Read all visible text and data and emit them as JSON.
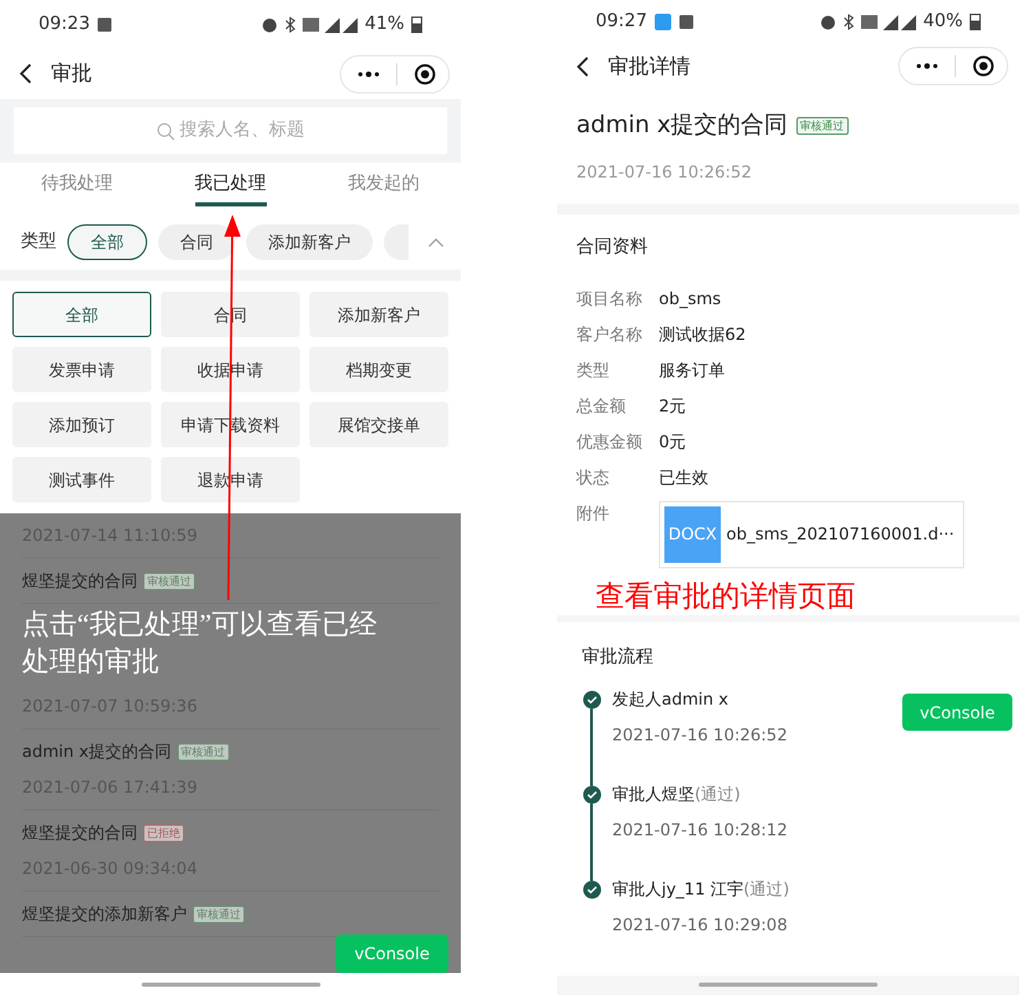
{
  "left_phone": {
    "status_bar": {
      "time": "09:23",
      "battery": "41%"
    },
    "nav": {
      "title": "审批"
    },
    "search": {
      "placeholder": "搜索人名、标题"
    },
    "tabs": [
      {
        "label": "待我处理",
        "selected": false
      },
      {
        "label": "我已处理",
        "selected": true
      },
      {
        "label": "我发起的",
        "selected": false
      }
    ],
    "filter": {
      "label": "类型",
      "chips": [
        {
          "label": "全部",
          "selected": true
        },
        {
          "label": "合同",
          "selected": false
        },
        {
          "label": "添加新客户",
          "selected": false
        }
      ]
    },
    "type_grid": [
      {
        "label": "全部",
        "selected": true
      },
      {
        "label": "合同",
        "selected": false
      },
      {
        "label": "添加新客户",
        "selected": false
      },
      {
        "label": "发票申请",
        "selected": false
      },
      {
        "label": "收据申请",
        "selected": false
      },
      {
        "label": "档期变更",
        "selected": false
      },
      {
        "label": "添加预订",
        "selected": false
      },
      {
        "label": "申请下载资料",
        "selected": false
      },
      {
        "label": "展馆交接单",
        "selected": false
      },
      {
        "label": "测试事件",
        "selected": false
      },
      {
        "label": "退款申请",
        "selected": false
      }
    ],
    "list": [
      {
        "date": "2021-07-14 11:10:59"
      },
      {
        "title": "煜坚提交的合同",
        "badge": {
          "label": "审核通过",
          "kind": "approved"
        }
      },
      {
        "date": "2021-07-07 10:59:36"
      },
      {
        "title": "admin x提交的合同",
        "badge": {
          "label": "审核通过",
          "kind": "approved"
        },
        "date": "2021-07-06 17:41:39"
      },
      {
        "title": "煜坚提交的合同",
        "badge": {
          "label": "已拒绝",
          "kind": "rejected"
        },
        "date": "2021-06-30 09:34:04"
      },
      {
        "title": "煜坚提交的添加新客户",
        "badge": {
          "label": "审核通过",
          "kind": "approved"
        }
      }
    ],
    "annotation": "点击“我已处理”可以查看已经处理的审批",
    "vconsole": "vConsole"
  },
  "right_phone": {
    "status_bar": {
      "time": "09:27",
      "battery": "40%"
    },
    "nav": {
      "title": "审批详情"
    },
    "header": {
      "title": "admin x提交的合同",
      "badge": {
        "label": "审核通过",
        "kind": "approved"
      },
      "date": "2021-07-16 10:26:52"
    },
    "contract": {
      "heading": "合同资料",
      "fields": [
        {
          "label": "项目名称",
          "value": "ob_sms"
        },
        {
          "label": "客户名称",
          "value": "测试收据62"
        },
        {
          "label": "类型",
          "value": "服务订单"
        },
        {
          "label": "总金额",
          "value": "2元"
        },
        {
          "label": "优惠金额",
          "value": "0元"
        },
        {
          "label": "状态",
          "value": "已生效"
        }
      ],
      "attachment": {
        "label": "附件",
        "type": "DOCX",
        "filename": "ob_sms_202107160001.d···"
      }
    },
    "annotation": "查看审批的详情页面",
    "flow": {
      "heading": "审批流程",
      "steps": [
        {
          "name": "发起人admin x",
          "date": "2021-07-16 10:26:52"
        },
        {
          "name": "审批人煜坚",
          "result": "(通过)",
          "date": "2021-07-16 10:28:12"
        },
        {
          "name": "审批人jy_11 江宇",
          "result": "(通过)",
          "date": "2021-07-16 10:29:08"
        }
      ]
    },
    "vconsole": "vConsole"
  }
}
